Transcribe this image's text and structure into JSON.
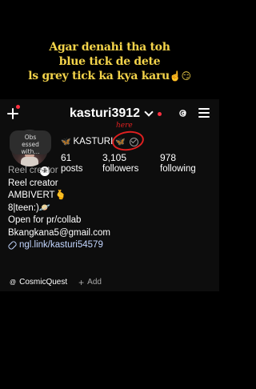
{
  "caption": {
    "line1": "Agar denahi tha toh",
    "line2": "blue tick de dete",
    "line3": "ls grey tick ka kya karu",
    "emoji": "☝️😏"
  },
  "topbar": {
    "username": "kasturi3912",
    "icons": [
      "plus-icon",
      "chevron-down-icon",
      "threads-icon",
      "menu-icon"
    ]
  },
  "profile": {
    "note_lines": [
      "Obs",
      "essed",
      "with..."
    ],
    "name": "KASTURI",
    "name_emoji_left": "🦋",
    "name_emoji_right": "🦋",
    "annotation": "here",
    "stats": [
      {
        "value": "61",
        "label": "posts"
      },
      {
        "value": "3,105",
        "label": "followers"
      },
      {
        "value": "978",
        "label": "following"
      }
    ],
    "bio": {
      "category": "Reel creator",
      "lines": [
        "Reel creator",
        "AMBIVERT🫰",
        "8|teen:)🪐",
        "Open for pr/collab",
        "Bkangkana5@gmail.com"
      ],
      "link": "ngl.link/kasturi54579"
    },
    "chips": {
      "thread_label": "CosmicQuest",
      "add_label": "Add"
    }
  },
  "colors": {
    "caption": "#f3d34a",
    "annotation": "#e02020",
    "notification": "#ff3040",
    "link": "#c3d6ff"
  }
}
